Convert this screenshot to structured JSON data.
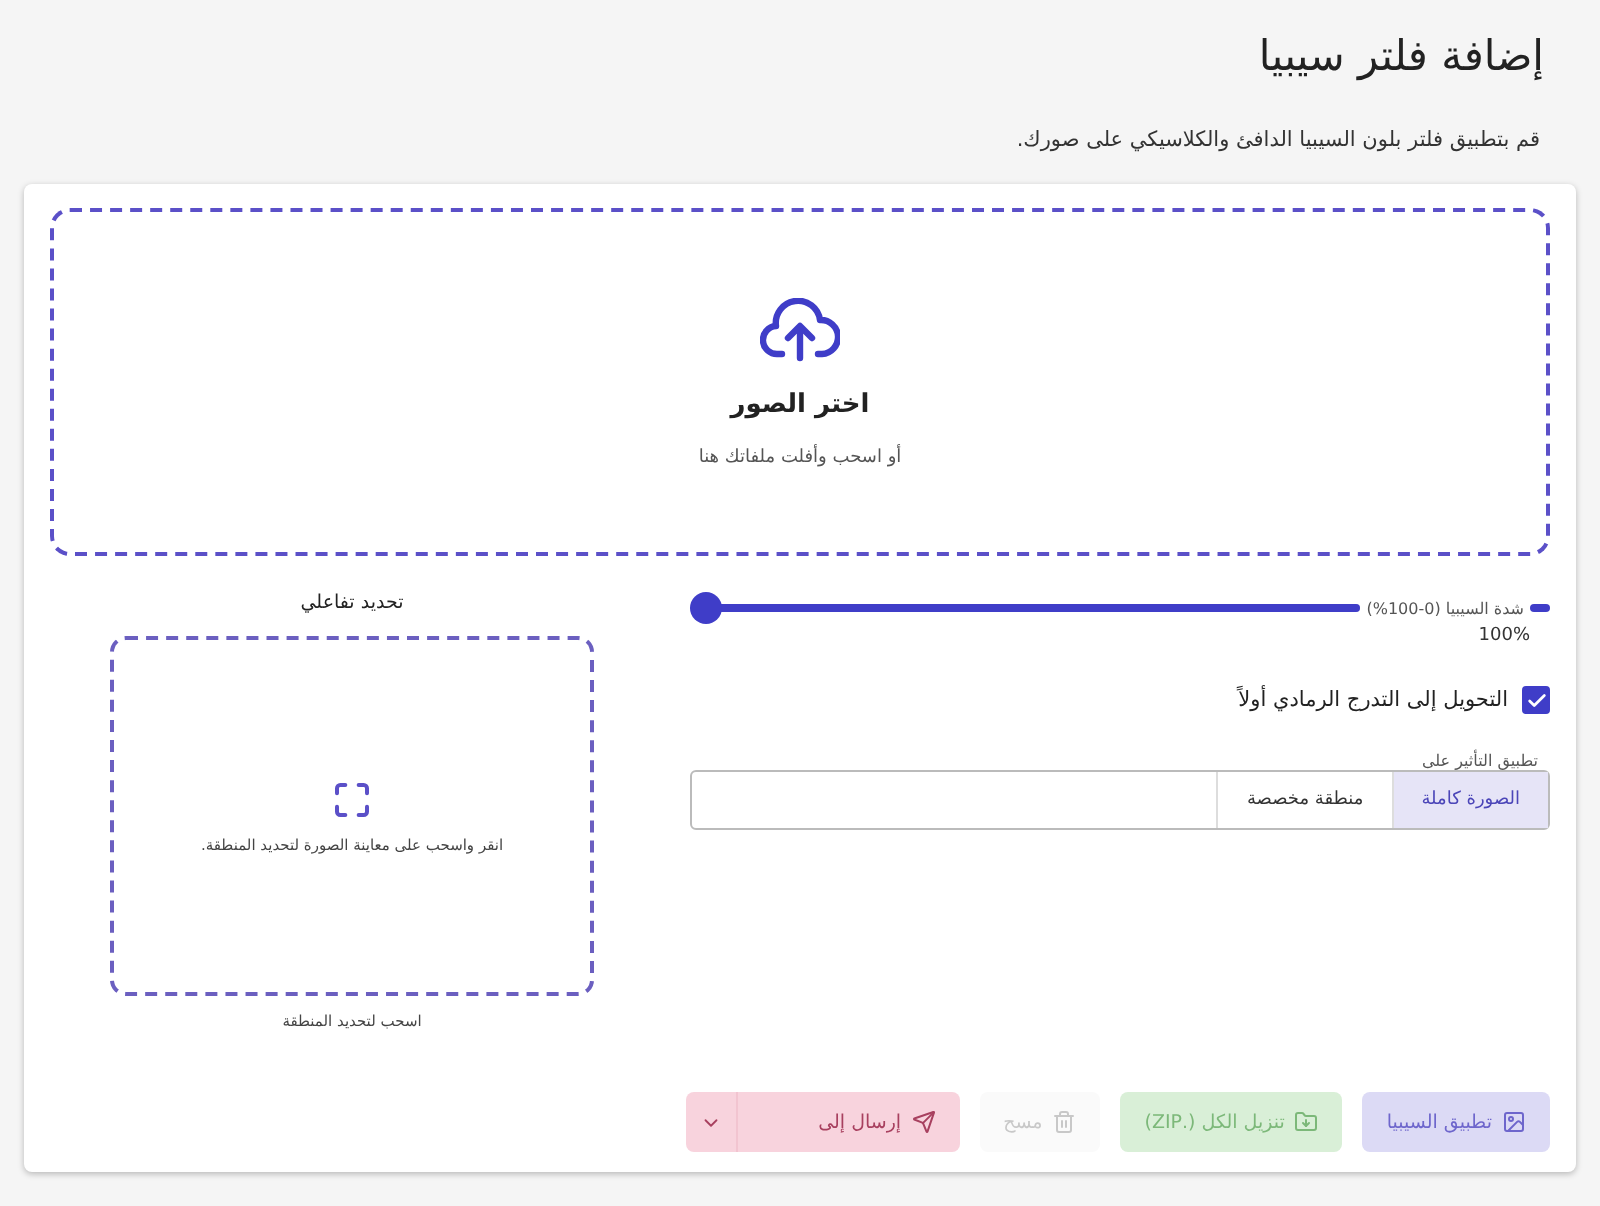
{
  "title": "إضافة فلتر سيبيا",
  "subtitle": "قم بتطبيق فلتر بلون السيبيا الدافئ والكلاسيكي على صورك.",
  "dropzone": {
    "title": "اختر الصور",
    "hint": "أو اسحب وأفلت ملفاتك هنا"
  },
  "intensity": {
    "label": "شدة السيبيا (0-100%)",
    "level": 1,
    "reading": "100%"
  },
  "grayscale": {
    "label": "التحويل إلى التدرج الرمادي أولاً",
    "checked": true
  },
  "apply_to": {
    "legend": "تطبيق التأثير على",
    "options": [
      {
        "label": "الصورة كاملة",
        "selected": true
      },
      {
        "label": "منطقة مخصصة",
        "selected": false
      }
    ]
  },
  "selection": {
    "title": "تحديد تفاعلي",
    "hint": "انقر واسحب على معاينة الصورة لتحديد المنطقة.",
    "caption": "اسحب لتحديد المنطقة"
  },
  "buttons": [
    {
      "kind": "apply",
      "label": "تطبيق السيبيا",
      "disabled": true
    },
    {
      "kind": "zip",
      "label": "تنزيل الكل (.ZIP)",
      "disabled": true
    },
    {
      "kind": "clear",
      "label": "مسح",
      "disabled": true
    },
    {
      "kind": "send",
      "label": "إرسال إلى",
      "disabled": true
    }
  ]
}
